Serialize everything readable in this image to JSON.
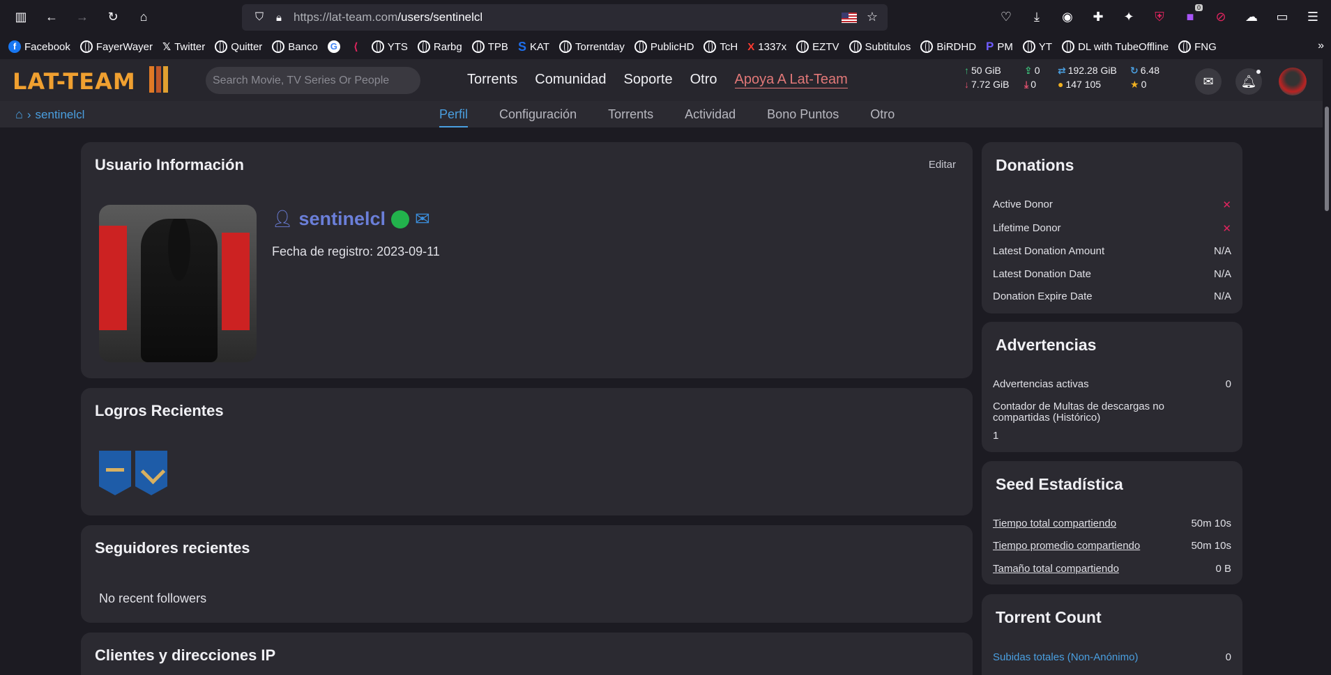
{
  "browser": {
    "url_host": "https://lat-team.com",
    "url_path": "/users/sentinelcl",
    "ext_badge": "0",
    "bookmarks": [
      "Facebook",
      "FayerWayer",
      "Twitter",
      "Quitter",
      "Banco",
      "",
      "",
      "YTS",
      "Rarbg",
      "TPB",
      "KAT",
      "Torrentday",
      "PublicHD",
      "TcH",
      "1337x",
      "EZTV",
      "Subtitulos",
      "BiRDHD",
      "PM",
      "YT",
      "DL with TubeOffline",
      "FNG"
    ]
  },
  "site": {
    "logo": "LAT-TEAM",
    "search_placeholder": "Search Movie, TV Series Or People",
    "nav": [
      "Torrents",
      "Comunidad",
      "Soporte",
      "Otro"
    ],
    "support_link": "Apoya A Lat-Team",
    "stats": {
      "upload": "50 GiB",
      "download": "7.72 GiB",
      "seeding": "0",
      "leeching": "0",
      "buffer": "192.28 GiB",
      "bonus": "147 105",
      "ratio": "6.48",
      "fl_tokens": "0"
    },
    "breadcrumb": "sentinelcl",
    "subnav": [
      "Perfil",
      "Configuración",
      "Torrents",
      "Actividad",
      "Bono Puntos",
      "Otro"
    ]
  },
  "profile": {
    "title": "Usuario Información",
    "edit": "Editar",
    "username": "sentinelcl",
    "registered": "Fecha de registro: 2023-09-11"
  },
  "achievements": {
    "title": "Logros Recientes"
  },
  "followers": {
    "title": "Seguidores recientes",
    "empty": "No recent followers"
  },
  "clients": {
    "title": "Clientes y direcciones IP"
  },
  "donations": {
    "title": "Donations",
    "rows": [
      {
        "k": "Active Donor",
        "v": "✕"
      },
      {
        "k": "Lifetime Donor",
        "v": "✕"
      },
      {
        "k": "Latest Donation Amount",
        "v": "N/A"
      },
      {
        "k": "Latest Donation Date",
        "v": "N/A"
      },
      {
        "k": "Donation Expire Date",
        "v": "N/A"
      }
    ]
  },
  "warnings": {
    "title": "Advertencias",
    "active_label": "Advertencias activas",
    "active_value": "0",
    "hnr_label": "Contador de Multas de descargas no compartidas (Histórico)",
    "hnr_value": "1"
  },
  "seed": {
    "title": "Seed Estadística",
    "rows": [
      {
        "k": "Tiempo total compartiendo",
        "v": "50m 10s"
      },
      {
        "k": "Tiempo promedio compartiendo",
        "v": "50m 10s"
      },
      {
        "k": "Tamaño total compartiendo",
        "v": "0 B"
      }
    ]
  },
  "torrent_count": {
    "title": "Torrent Count",
    "row_label": "Subidas totales (Non-Anónimo)",
    "row_value": "0"
  }
}
